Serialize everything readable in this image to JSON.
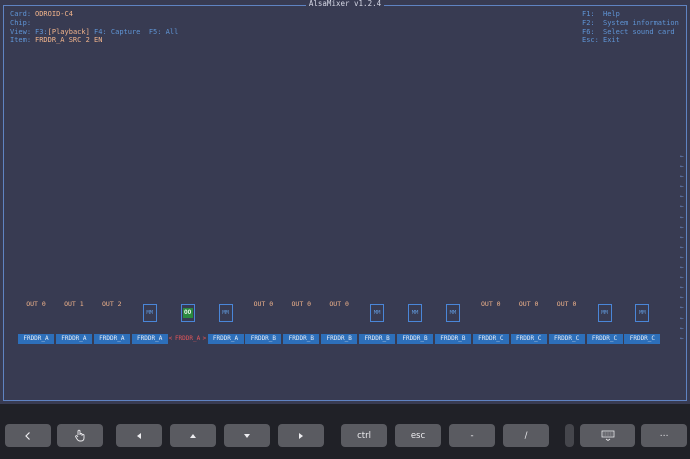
{
  "app": {
    "title": "AlsaMixer v1.2.4"
  },
  "info": {
    "card_label": "Card:",
    "card_value": "ODROID-C4",
    "chip_label": "Chip:",
    "chip_value": "",
    "view_label": "View:",
    "view_playback_key": "F3:",
    "view_playback": "[Playback]",
    "view_capture": "F4: Capture",
    "view_all": "F5: All",
    "item_label": "Item:",
    "item_value": "FRDDR_A SRC 2 EN"
  },
  "keys": [
    {
      "key": "F1:",
      "action": "Help"
    },
    {
      "key": "F2:",
      "action": "System information"
    },
    {
      "key": "F6:",
      "action": "Select sound card"
    },
    {
      "key": "Esc:",
      "action": "Exit"
    }
  ],
  "scroll_marks": [
    "←",
    "←",
    "←",
    "←",
    "←",
    "←",
    "←",
    "←",
    "←",
    "←",
    "←",
    "←",
    "←",
    "←",
    "←",
    "←",
    "←",
    "←",
    "←"
  ],
  "channels": [
    {
      "type": "enum",
      "value": "OUT 0",
      "name": "FRDDR_A",
      "selected": false
    },
    {
      "type": "enum",
      "value": "OUT 1",
      "name": "FRDDR_A",
      "selected": false
    },
    {
      "type": "enum",
      "value": "OUT 2",
      "name": "FRDDR_A",
      "selected": false
    },
    {
      "type": "switch",
      "value": "MM",
      "name": "FRDDR_A",
      "selected": false
    },
    {
      "type": "switch-on",
      "value": "OO",
      "name": "FRDDR_A",
      "selected": true
    },
    {
      "type": "switch",
      "value": "MM",
      "name": "FRDDR_A",
      "selected": false
    },
    {
      "type": "enum",
      "value": "OUT 0",
      "name": "FRDDR_B",
      "selected": false
    },
    {
      "type": "enum",
      "value": "OUT 0",
      "name": "FRDDR_B",
      "selected": false
    },
    {
      "type": "enum",
      "value": "OUT 0",
      "name": "FRDDR_B",
      "selected": false
    },
    {
      "type": "switch",
      "value": "MM",
      "name": "FRDDR_B",
      "selected": false
    },
    {
      "type": "switch",
      "value": "MM",
      "name": "FRDDR_B",
      "selected": false
    },
    {
      "type": "switch",
      "value": "MM",
      "name": "FRDDR_B",
      "selected": false
    },
    {
      "type": "enum",
      "value": "OUT 0",
      "name": "FRDDR_C",
      "selected": false
    },
    {
      "type": "enum",
      "value": "OUT 0",
      "name": "FRDDR_C",
      "selected": false
    },
    {
      "type": "enum",
      "value": "OUT 0",
      "name": "FRDDR_C",
      "selected": false
    },
    {
      "type": "switch",
      "value": "MM",
      "name": "FRDDR_C",
      "selected": false
    },
    {
      "type": "switch",
      "value": "MM",
      "name": "FRDDR_C",
      "selected": false
    }
  ],
  "selection_marks": {
    "left": "<",
    "right": ">"
  },
  "touchbar": {
    "back_icon": "chevron-left-icon",
    "touch_icon": "hand-pointer-icon",
    "left_icon": "arrow-left-icon",
    "up_icon": "arrow-up-icon",
    "down_icon": "arrow-down-icon",
    "right_icon": "arrow-right-icon",
    "ctrl": "ctrl",
    "esc": "esc",
    "minus": "-",
    "slash": "/",
    "keyboard_icon": "keyboard-icon",
    "more": "⋯"
  },
  "colors": {
    "terminal_bg": "#383b52",
    "frame": "#5f83c2",
    "label_blue": "#5f95d6",
    "value_orange": "#f0b38b",
    "name_bg": "#2d6fba",
    "selected_red": "#e2565a",
    "switch_on_green": "#2b8a40",
    "touchbar_bg": "#202127",
    "key_bg": "#5a5b61"
  }
}
